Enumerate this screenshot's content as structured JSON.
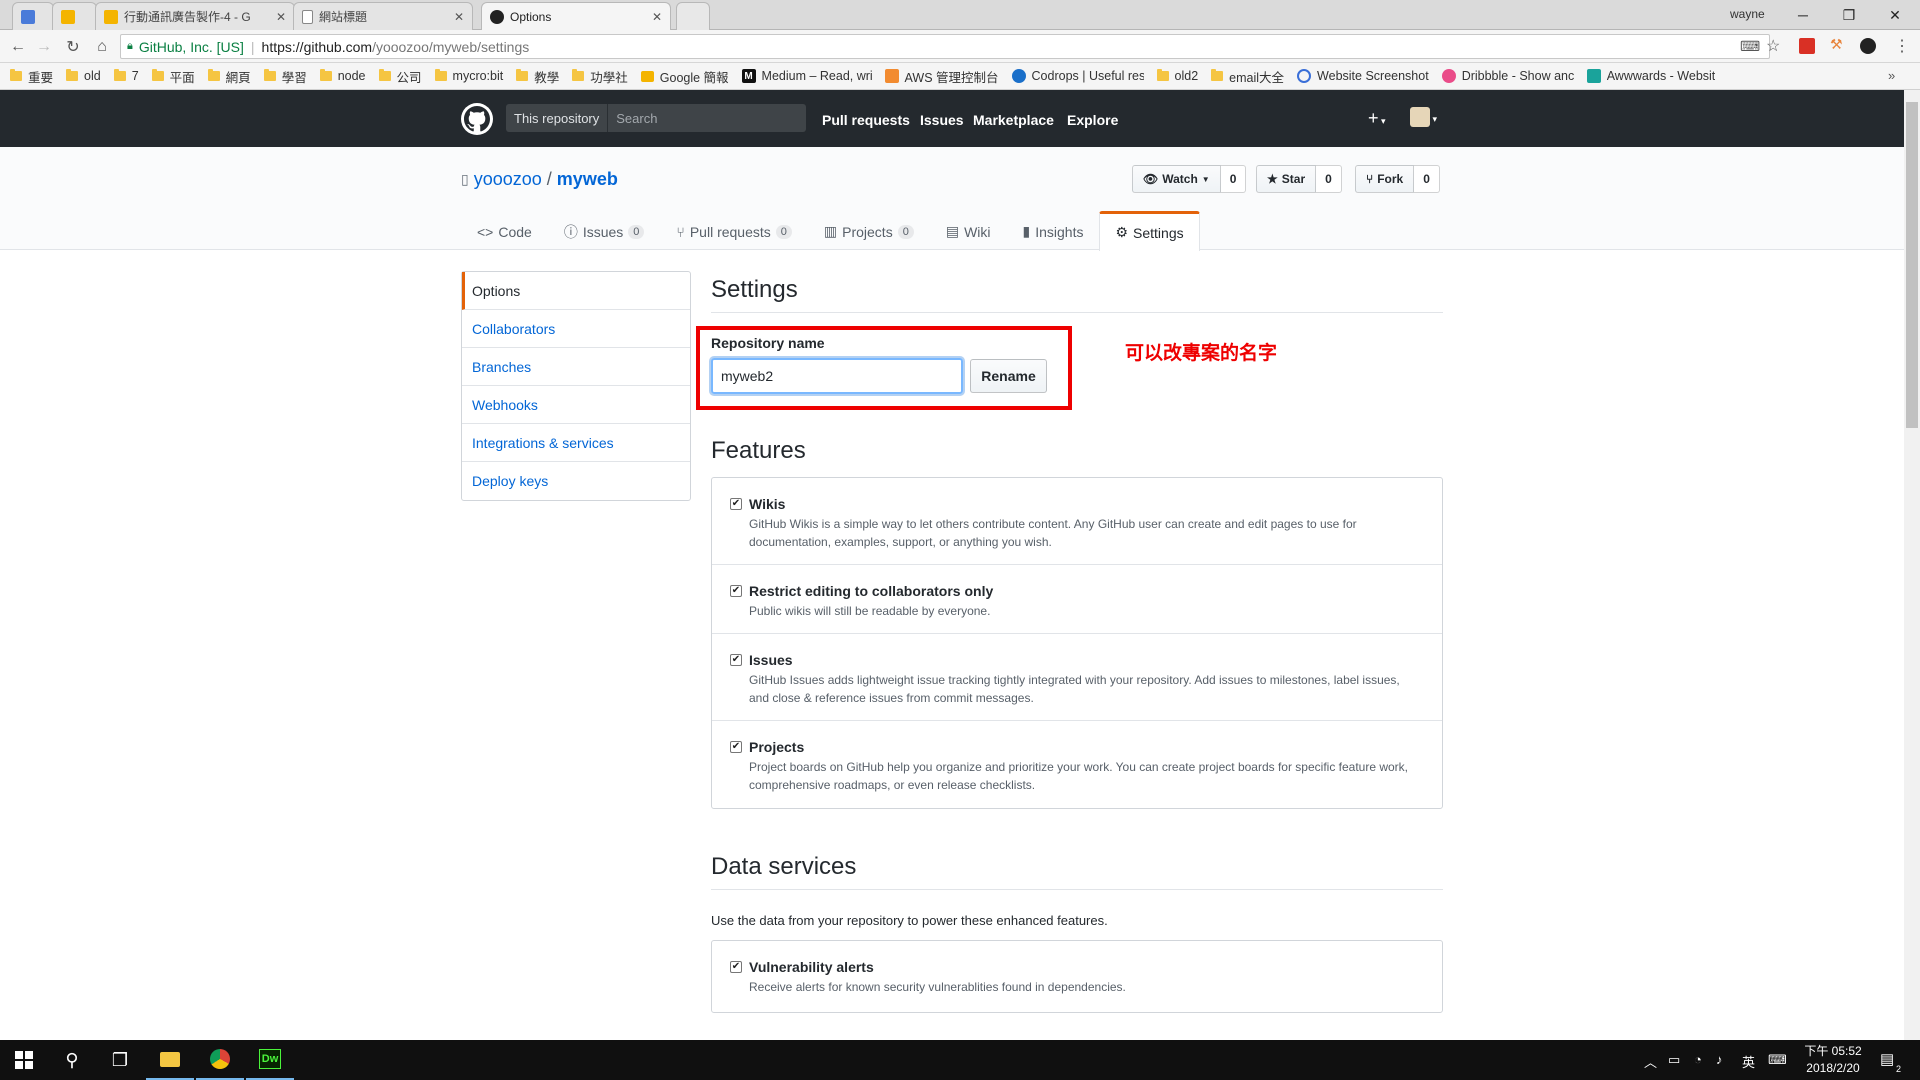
{
  "browser": {
    "tabs": [
      {
        "label": "",
        "active": false
      },
      {
        "label": "",
        "active": false
      },
      {
        "label": "行動通訊廣告製作-4 - G",
        "active": false
      },
      {
        "label": "網站標題",
        "active": false
      },
      {
        "label": "Options",
        "active": true
      }
    ],
    "profile": "wayne",
    "secure_label": "GitHub, Inc. [US]",
    "url_host": "https://github.com",
    "url_path": "/yooozoo/myweb/settings",
    "bookmarks": [
      "重要",
      "old",
      "7",
      "平面",
      "網頁",
      "學習",
      "node",
      "公司",
      "mycro:bit",
      "教學",
      "功學社",
      "Google 簡報",
      "Medium – Read, wri",
      "AWS 管理控制台",
      "Codrops | Useful res",
      "old2",
      "email大全",
      "Website Screenshot",
      "Dribbble - Show anc",
      "Awwwards - Websit"
    ]
  },
  "github": {
    "scope_label": "This repository",
    "search_placeholder": "Search",
    "nav": [
      "Pull requests",
      "Issues",
      "Marketplace",
      "Explore"
    ],
    "owner": "yooozoo",
    "repo": "myweb",
    "watch": {
      "label": "Watch",
      "count": "0"
    },
    "star": {
      "label": "Star",
      "count": "0"
    },
    "fork": {
      "label": "Fork",
      "count": "0"
    },
    "tabs": [
      {
        "label": "Code",
        "count": null
      },
      {
        "label": "Issues",
        "count": "0"
      },
      {
        "label": "Pull requests",
        "count": "0"
      },
      {
        "label": "Projects",
        "count": "0"
      },
      {
        "label": "Wiki",
        "count": null
      },
      {
        "label": "Insights",
        "count": null
      },
      {
        "label": "Settings",
        "count": null
      }
    ],
    "menu": [
      "Options",
      "Collaborators",
      "Branches",
      "Webhooks",
      "Integrations & services",
      "Deploy keys"
    ],
    "settings_title": "Settings",
    "repo_name_label": "Repository name",
    "repo_name_value": "myweb2",
    "rename_label": "Rename",
    "annotation": "可以改專案的名字",
    "features_title": "Features",
    "features": [
      {
        "title": "Wikis",
        "desc": "GitHub Wikis is a simple way to let others contribute content. Any GitHub user can create and edit pages to use for documentation, examples, support, or anything you wish.",
        "checked": true
      },
      {
        "title": "Restrict editing to collaborators only",
        "desc": "Public wikis will still be readable by everyone.",
        "checked": true
      },
      {
        "title": "Issues",
        "desc": "GitHub Issues adds lightweight issue tracking tightly integrated with your repository. Add issues to milestones, label issues, and close & reference issues from commit messages.",
        "checked": true
      },
      {
        "title": "Projects",
        "desc": "Project boards on GitHub help you organize and prioritize your work. You can create project boards for specific feature work, comprehensive roadmaps, or even release checklists.",
        "checked": true
      }
    ],
    "data_services_title": "Data services",
    "data_services_desc": "Use the data from your repository to power these enhanced features.",
    "data_services": [
      {
        "title": "Vulnerability alerts",
        "desc": "Receive alerts for known security vulnerablities found in dependencies.",
        "checked": true
      }
    ]
  },
  "taskbar": {
    "ime": "英",
    "time": "下午 05:52",
    "date": "2018/2/20",
    "notifications": "2"
  }
}
